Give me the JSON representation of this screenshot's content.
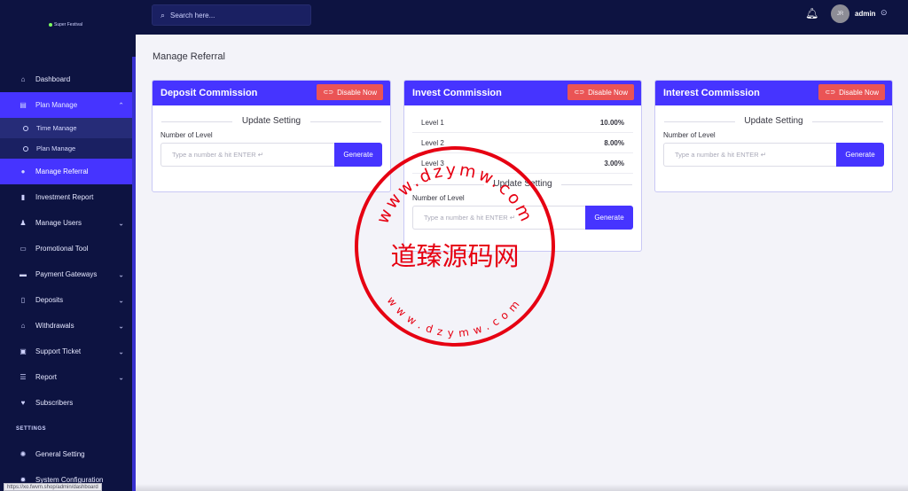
{
  "brand": {
    "name": "Super Festival"
  },
  "topbar": {
    "search_placeholder": "Search here...",
    "user_initials": "JR",
    "user_name": "admin"
  },
  "sidebar": {
    "items": [
      {
        "label": "Dashboard",
        "icon": "home-icon"
      },
      {
        "label": "Plan Manage",
        "icon": "clipboard-icon",
        "expanded": true,
        "children": [
          {
            "label": "Time Manage"
          },
          {
            "label": "Plan Manage"
          }
        ]
      },
      {
        "label": "Manage Referral",
        "icon": "drop-icon",
        "active": true
      },
      {
        "label": "Investment Report",
        "icon": "bar-chart-icon"
      },
      {
        "label": "Manage Users",
        "icon": "users-icon"
      },
      {
        "label": "Promotional Tool",
        "icon": "image-icon"
      },
      {
        "label": "Payment Gateways",
        "icon": "credit-card-icon"
      },
      {
        "label": "Deposits",
        "icon": "file-icon"
      },
      {
        "label": "Withdrawals",
        "icon": "bank-icon"
      },
      {
        "label": "Support Ticket",
        "icon": "ticket-icon"
      },
      {
        "label": "Report",
        "icon": "list-icon"
      },
      {
        "label": "Subscribers",
        "icon": "thumbs-up-icon"
      }
    ],
    "section_settings": "SETTINGS",
    "settings_items": [
      {
        "label": "General Setting",
        "icon": "cog-icon"
      },
      {
        "label": "System Configuration",
        "icon": "gear-icon"
      }
    ]
  },
  "page": {
    "title": "Manage Referral"
  },
  "cards": {
    "deposit": {
      "title": "Deposit Commission",
      "disable_label": "Disable Now",
      "update_title": "Update Setting",
      "field_label": "Number of Level",
      "input_placeholder": "Type a number & hit ENTER ↵",
      "generate_label": "Generate"
    },
    "invest": {
      "title": "Invest Commission",
      "disable_label": "Disable Now",
      "levels": [
        {
          "name": "Level 1",
          "value": "10.00%"
        },
        {
          "name": "Level 2",
          "value": "8.00%"
        },
        {
          "name": "Level 3",
          "value": "3.00%"
        }
      ],
      "update_title": "Update Setting",
      "field_label": "Number of Level",
      "input_placeholder": "Type a number & hit ENTER ↵",
      "generate_label": "Generate"
    },
    "interest": {
      "title": "Interest Commission",
      "disable_label": "Disable Now",
      "update_title": "Update Setting",
      "field_label": "Number of Level",
      "input_placeholder": "Type a number & hit ENTER ↵",
      "generate_label": "Generate"
    }
  },
  "watermark": {
    "main": "道臻源码网",
    "top_arc": "www.dzymw.com",
    "bottom_arc": "www.dzymw.com"
  },
  "status_url": "https://xo.fwvm.shop/admin/dashboard",
  "colors": {
    "primary": "#4634ff",
    "sidebar": "#0d1341",
    "danger": "#ea5455",
    "stamp": "#e60012"
  }
}
